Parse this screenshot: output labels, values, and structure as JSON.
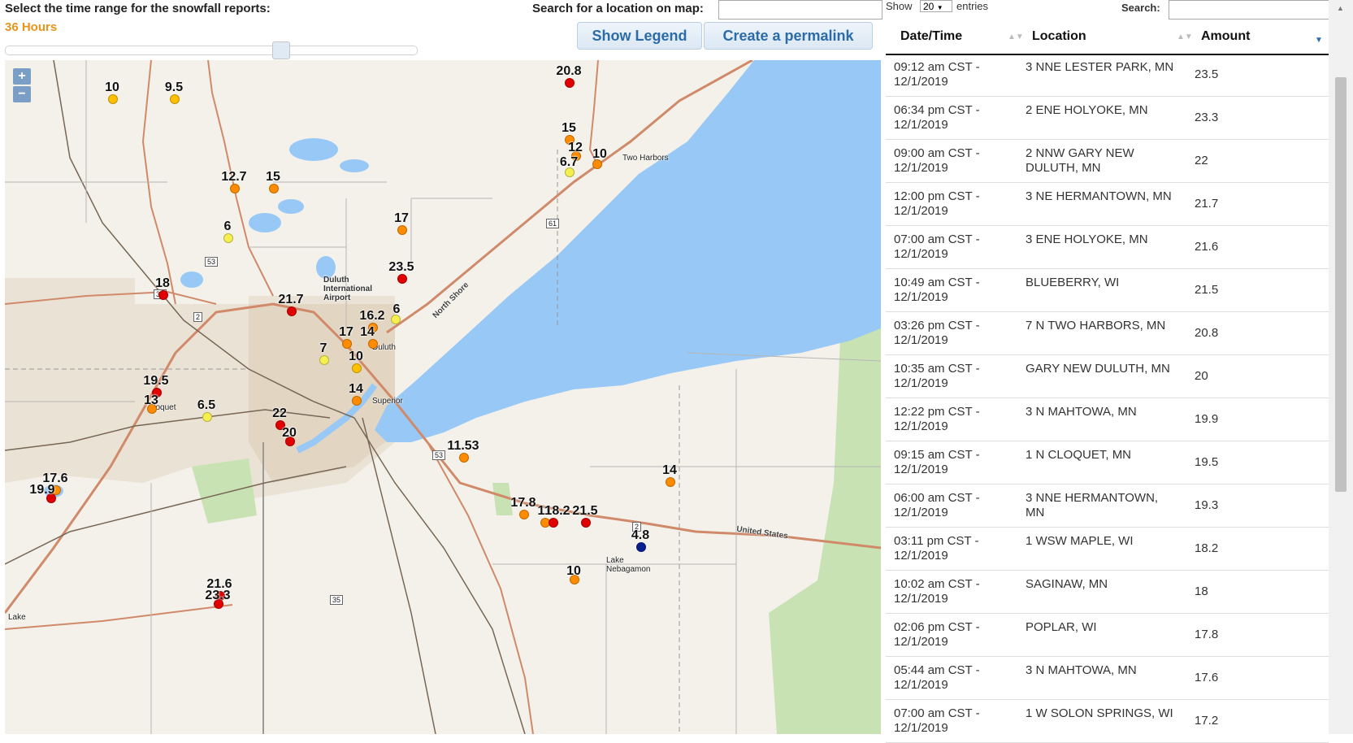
{
  "controls": {
    "time_range_label": "Select the time range for the snowfall reports:",
    "time_range_value": "36 Hours",
    "search_map_label": "Search for a location on map:",
    "show_legend_label": "Show Legend",
    "permalink_label": "Create a permalink",
    "slider_fraction": 0.67
  },
  "colors": {
    "accent": "#e8941a",
    "button_text": "#2b6ca8",
    "water": "#98c8f5",
    "red": "#e00000",
    "orange": "#ff8c00",
    "yellow": "#ffc000",
    "lightyellow": "#f5ef50",
    "blue": "#0a1f8f"
  },
  "map": {
    "zoom_in": "+",
    "zoom_out": "−",
    "markers": [
      {
        "label": "10",
        "color": "yellow"
      },
      {
        "label": "9.5",
        "color": "yellow"
      },
      {
        "label": "20.8",
        "color": "red"
      },
      {
        "label": "15",
        "color": "orange"
      },
      {
        "label": "12",
        "color": "orange"
      },
      {
        "label": "10",
        "color": "orange"
      },
      {
        "label": "6.7",
        "color": "lightyellow"
      },
      {
        "label": "12.7",
        "color": "orange"
      },
      {
        "label": "15",
        "color": "orange"
      },
      {
        "label": "17",
        "color": "orange"
      },
      {
        "label": "6",
        "color": "lightyellow"
      },
      {
        "label": "23.5",
        "color": "red"
      },
      {
        "label": "18",
        "color": "red"
      },
      {
        "label": "21.7",
        "color": "red"
      },
      {
        "label": "16.2",
        "color": "orange"
      },
      {
        "label": "6",
        "color": "lightyellow"
      },
      {
        "label": "17",
        "color": "orange"
      },
      {
        "label": "14",
        "color": "orange"
      },
      {
        "label": "7",
        "color": "lightyellow"
      },
      {
        "label": "10",
        "color": "yellow"
      },
      {
        "label": "14",
        "color": "orange"
      },
      {
        "label": "19.5",
        "color": "red"
      },
      {
        "label": "13",
        "color": "orange"
      },
      {
        "label": "6.5",
        "color": "lightyellow"
      },
      {
        "label": "22",
        "color": "red"
      },
      {
        "label": "20",
        "color": "red"
      },
      {
        "label": "11.53",
        "color": "orange"
      },
      {
        "label": "14",
        "color": "orange"
      },
      {
        "label": "17.6",
        "color": "orange"
      },
      {
        "label": "19.9",
        "color": "red"
      },
      {
        "label": "17.8",
        "color": "orange"
      },
      {
        "label": "11",
        "color": "orange"
      },
      {
        "label": "18.2",
        "color": "red"
      },
      {
        "label": "21.5",
        "color": "red"
      },
      {
        "label": "4.8",
        "color": "blue"
      },
      {
        "label": "10",
        "color": "orange"
      },
      {
        "label": "21.6",
        "color": "red"
      },
      {
        "label": "23.3",
        "color": "red"
      }
    ],
    "places": [
      {
        "name": "Two Harbors"
      },
      {
        "name": "Duluth International Airport"
      },
      {
        "name": "Duluth"
      },
      {
        "name": "Superior"
      },
      {
        "name": "Cloquet"
      },
      {
        "name": "Lake Nebagamon"
      },
      {
        "name": "Lake"
      },
      {
        "name": "United States"
      },
      {
        "name": "North Shore"
      }
    ],
    "shields": [
      "53",
      "33",
      "2",
      "61",
      "53",
      "2",
      "35"
    ]
  },
  "table": {
    "show_label": "Show",
    "show_value": "20",
    "entries_label": "entries",
    "search_label": "Search:",
    "headers": [
      "Date/Time",
      "Location",
      "Amount"
    ],
    "rows": [
      {
        "time": "09:12 am CST - 12/1/2019",
        "location": "3 NNE LESTER PARK, MN",
        "amount": "23.5"
      },
      {
        "time": "06:34 pm CST - 12/1/2019",
        "location": "2 ENE HOLYOKE, MN",
        "amount": "23.3"
      },
      {
        "time": "09:00 am CST - 12/1/2019",
        "location": "2 NNW GARY NEW DULUTH, MN",
        "amount": "22"
      },
      {
        "time": "12:00 pm CST - 12/1/2019",
        "location": "3 NE HERMANTOWN, MN",
        "amount": "21.7"
      },
      {
        "time": "07:00 am CST - 12/1/2019",
        "location": "3 ENE HOLYOKE, MN",
        "amount": "21.6"
      },
      {
        "time": "10:49 am CST - 12/1/2019",
        "location": "BLUEBERRY, WI",
        "amount": "21.5"
      },
      {
        "time": "03:26 pm CST - 12/1/2019",
        "location": "7 N TWO HARBORS, MN",
        "amount": "20.8"
      },
      {
        "time": "10:35 am CST - 12/1/2019",
        "location": "GARY NEW DULUTH, MN",
        "amount": "20"
      },
      {
        "time": "12:22 pm CST - 12/1/2019",
        "location": "3 N MAHTOWA, MN",
        "amount": "19.9"
      },
      {
        "time": "09:15 am CST - 12/1/2019",
        "location": "1 N CLOQUET, MN",
        "amount": "19.5"
      },
      {
        "time": "06:00 am CST - 12/1/2019",
        "location": "3 NNE HERMANTOWN, MN",
        "amount": "19.3"
      },
      {
        "time": "03:11 pm CST - 12/1/2019",
        "location": "1 WSW MAPLE, WI",
        "amount": "18.2"
      },
      {
        "time": "10:02 am CST - 12/1/2019",
        "location": "SAGINAW, MN",
        "amount": "18"
      },
      {
        "time": "02:06 pm CST - 12/1/2019",
        "location": "POPLAR, WI",
        "amount": "17.8"
      },
      {
        "time": "05:44 am CST - 12/1/2019",
        "location": "3 N MAHTOWA, MN",
        "amount": "17.6"
      },
      {
        "time": "07:00 am CST - 12/1/2019",
        "location": "1 W SOLON SPRINGS, WI",
        "amount": "17.2"
      }
    ]
  }
}
